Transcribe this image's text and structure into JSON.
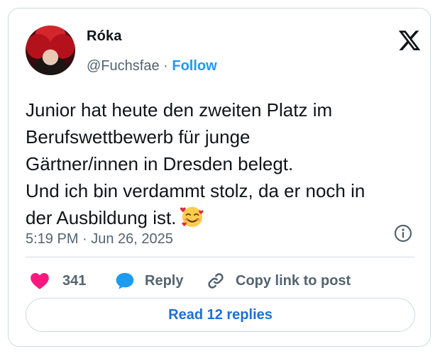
{
  "author": {
    "name": "Róka",
    "handle": "@Fuchsfae",
    "separator": "·",
    "follow_label": "Follow"
  },
  "tweet": {
    "lines": [
      "Junior hat heute den zweiten Platz im",
      "Berufswettbewerb für junge",
      "Gärtner/innen in Dresden belegt.",
      "Und ich bin verdammt stolz, da er noch in",
      "der Ausbildung ist."
    ],
    "emoji": "smiling-face-with-hearts"
  },
  "meta": {
    "timestamp": "5:19 PM · Jun 26, 2025"
  },
  "actions": {
    "like_count": "341",
    "reply_label": "Reply",
    "copy_label": "Copy link to post"
  },
  "footer": {
    "read_replies_label": "Read 12 replies"
  },
  "colors": {
    "accent": "#1d9bf0",
    "heart": "#f91880",
    "secondary_text": "#536471",
    "border": "#cfd9de"
  },
  "icons": {
    "brand": "x-logo-icon",
    "info": "info-icon",
    "like": "heart-icon",
    "reply": "speech-bubble-icon",
    "copy": "link-icon"
  }
}
